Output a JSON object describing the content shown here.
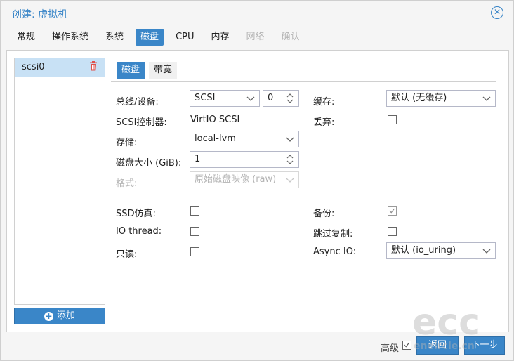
{
  "window": {
    "title": "创建: 虚拟机"
  },
  "tabs": [
    {
      "label": "常规",
      "state": "normal"
    },
    {
      "label": "操作系统",
      "state": "normal"
    },
    {
      "label": "系统",
      "state": "normal"
    },
    {
      "label": "磁盘",
      "state": "active"
    },
    {
      "label": "CPU",
      "state": "normal"
    },
    {
      "label": "内存",
      "state": "normal"
    },
    {
      "label": "网络",
      "state": "disabled"
    },
    {
      "label": "确认",
      "state": "disabled"
    }
  ],
  "disk_list": {
    "items": [
      {
        "label": "scsi0",
        "selected": true
      }
    ],
    "add_label": "添加"
  },
  "subtabs": [
    {
      "label": "磁盘",
      "active": true
    },
    {
      "label": "带宽",
      "active": false
    }
  ],
  "form": {
    "bus_label": "总线/设备:",
    "bus_value": "SCSI",
    "device_index": "0",
    "scsi_ctrl_label": "SCSI控制器:",
    "scsi_ctrl_value": "VirtIO SCSI",
    "storage_label": "存储:",
    "storage_value": "local-lvm",
    "disk_size_label": "磁盘大小 (GiB):",
    "disk_size_value": "1",
    "format_label": "格式:",
    "format_value": "原始磁盘映像 (raw)",
    "cache_label": "缓存:",
    "cache_value": "默认 (无缓存)",
    "discard_label": "丢弃:",
    "discard_checked": false,
    "ssd_label": "SSD仿真:",
    "ssd_checked": false,
    "iothread_label": "IO thread:",
    "iothread_checked": false,
    "readonly_label": "只读:",
    "readonly_checked": false,
    "backup_label": "备份:",
    "backup_checked": true,
    "skip_repl_label": "跳过复制:",
    "skip_repl_checked": false,
    "async_io_label": "Async IO:",
    "async_io_value": "默认 (io_uring)"
  },
  "footer": {
    "advanced_label": "高级",
    "advanced_checked": true,
    "back_label": "返回",
    "next_label": "下一步"
  },
  "watermark": {
    "big": "ecc",
    "small": "eneircle.cn"
  },
  "colors": {
    "accent": "#3a86c8",
    "selected_row": "#c8e1f5",
    "trash": "#e0504a"
  }
}
